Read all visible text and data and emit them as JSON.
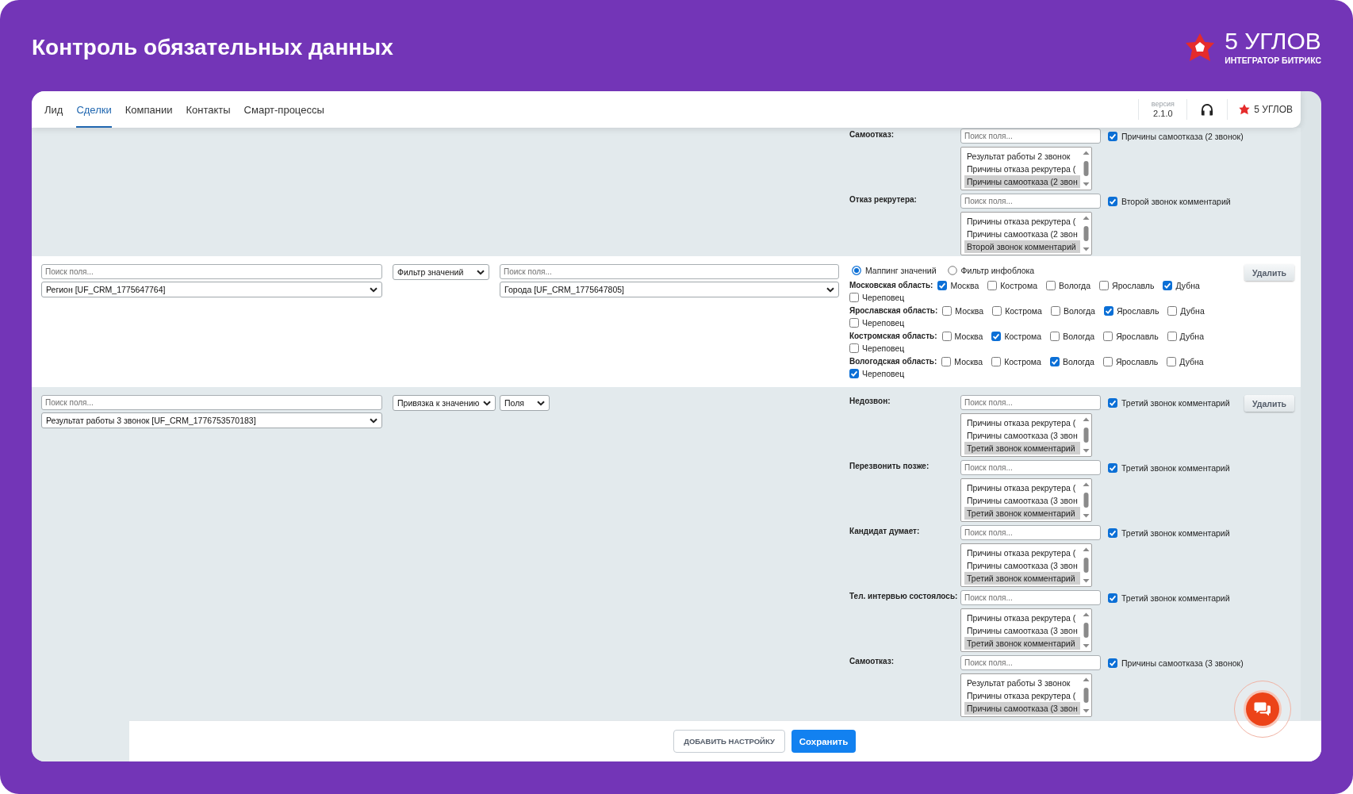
{
  "header": {
    "title": "Контроль обязательных данных",
    "brand": "5 УГЛОВ",
    "tagline": "ИНТЕГРАТОР БИТРИКС"
  },
  "tabs": [
    {
      "label": "Лид",
      "selected": false
    },
    {
      "label": "Сделки",
      "selected": true
    },
    {
      "label": "Компании",
      "selected": false
    },
    {
      "label": "Контакты",
      "selected": false
    },
    {
      "label": "Смарт-процессы",
      "selected": false
    }
  ],
  "toolbar": {
    "version_caption": "версия",
    "version": "2.1.0",
    "brand": "5 УГЛОВ"
  },
  "rows": [
    {
      "kind": "binding",
      "entries": [
        {
          "label": "Самоотказ:",
          "search": {
            "placeholder": "Поиск поля..."
          },
          "check": {
            "label": "Причины самоотказа (2 звонок)",
            "checked": true
          },
          "options": [
            {
              "label": "Результат работы 2 звонок",
              "selected": false
            },
            {
              "label": "Причины отказа рекрутера (",
              "selected": false
            },
            {
              "label": "Причины самоотказа (2 звон",
              "selected": true
            }
          ]
        },
        {
          "label": "Отказ рекрутера:",
          "search": {
            "placeholder": "Поиск поля..."
          },
          "check": {
            "label": "Второй звонок комментарий",
            "checked": true
          },
          "options": [
            {
              "label": "Причины отказа рекрутера (",
              "selected": false
            },
            {
              "label": "Причины самоотказа (2 звон",
              "selected": false
            },
            {
              "label": "Второй звонок комментарий",
              "selected": true
            }
          ]
        }
      ]
    },
    {
      "kind": "filter",
      "source_search": {
        "placeholder": "Поиск поля..."
      },
      "source_field": "Регион [UF_CRM_1775647764]",
      "mode": "Фильтр значений",
      "target_search": {
        "placeholder": "Поиск поля..."
      },
      "target_field": "Города [UF_CRM_1775647805]",
      "delete": "Удалить",
      "modes": [
        {
          "label": "Маппинг значений",
          "selected": true
        },
        {
          "label": "Фильтр инфоблока",
          "selected": false
        }
      ],
      "groups": [
        {
          "label": "Московская область:",
          "cities": [
            {
              "label": "Москва",
              "checked": true
            },
            {
              "label": "Кострома",
              "checked": false
            },
            {
              "label": "Вологда",
              "checked": false
            },
            {
              "label": "Ярославль",
              "checked": false
            },
            {
              "label": "Дубна",
              "checked": true
            },
            {
              "label": "Череповец",
              "checked": false
            }
          ]
        },
        {
          "label": "Ярославская область:",
          "cities": [
            {
              "label": "Москва",
              "checked": false
            },
            {
              "label": "Кострома",
              "checked": false
            },
            {
              "label": "Вологда",
              "checked": false
            },
            {
              "label": "Ярославль",
              "checked": true
            },
            {
              "label": "Дубна",
              "checked": false
            },
            {
              "label": "Череповец",
              "checked": false
            }
          ]
        },
        {
          "label": "Костромская область:",
          "cities": [
            {
              "label": "Москва",
              "checked": false
            },
            {
              "label": "Кострома",
              "checked": true
            },
            {
              "label": "Вологда",
              "checked": false
            },
            {
              "label": "Ярославль",
              "checked": false
            },
            {
              "label": "Дубна",
              "checked": false
            },
            {
              "label": "Череповец",
              "checked": false
            }
          ]
        },
        {
          "label": "Вологодская область:",
          "cities": [
            {
              "label": "Москва",
              "checked": false
            },
            {
              "label": "Кострома",
              "checked": false
            },
            {
              "label": "Вологда",
              "checked": true
            },
            {
              "label": "Ярославль",
              "checked": false
            },
            {
              "label": "Дубна",
              "checked": false
            },
            {
              "label": "Череповец",
              "checked": true
            }
          ]
        }
      ]
    },
    {
      "kind": "binding",
      "source_search": {
        "placeholder": "Поиск поля..."
      },
      "source_field": "Результат работы 3 звонок [UF_CRM_1776753570183]",
      "mode": "Привязка к значению",
      "target_type": "Поля",
      "delete": "Удалить",
      "entries": [
        {
          "label": "Недозвон:",
          "search": {
            "placeholder": "Поиск поля..."
          },
          "check": {
            "label": "Третий звонок комментарий",
            "checked": true
          },
          "options": [
            {
              "label": "Причины отказа рекрутера (",
              "selected": false
            },
            {
              "label": "Причины самоотказа (3 звон",
              "selected": false
            },
            {
              "label": "Третий звонок комментарий",
              "selected": true
            }
          ]
        },
        {
          "label": "Перезвонить позже:",
          "search": {
            "placeholder": "Поиск поля..."
          },
          "check": {
            "label": "Третий звонок комментарий",
            "checked": true
          },
          "options": [
            {
              "label": "Причины отказа рекрутера (",
              "selected": false
            },
            {
              "label": "Причины самоотказа (3 звон",
              "selected": false
            },
            {
              "label": "Третий звонок комментарий",
              "selected": true
            }
          ]
        },
        {
          "label": "Кандидат думает:",
          "search": {
            "placeholder": "Поиск поля..."
          },
          "check": {
            "label": "Третий звонок комментарий",
            "checked": true
          },
          "options": [
            {
              "label": "Причины отказа рекрутера (",
              "selected": false
            },
            {
              "label": "Причины самоотказа (3 звон",
              "selected": false
            },
            {
              "label": "Третий звонок комментарий",
              "selected": true
            }
          ]
        },
        {
          "label": "Тел. интервью состоялось:",
          "search": {
            "placeholder": "Поиск поля..."
          },
          "check": {
            "label": "Третий звонок комментарий",
            "checked": true
          },
          "options": [
            {
              "label": "Причины отказа рекрутера (",
              "selected": false
            },
            {
              "label": "Причины самоотказа (3 звон",
              "selected": false
            },
            {
              "label": "Третий звонок комментарий",
              "selected": true
            }
          ]
        },
        {
          "label": "Самоотказ:",
          "search": {
            "placeholder": "Поиск поля..."
          },
          "check": {
            "label": "Причины самоотказа (3 звонок)",
            "checked": true
          },
          "options": [
            {
              "label": "Результат работы 3 звонок",
              "selected": false
            },
            {
              "label": "Причины отказа рекрутера (",
              "selected": false
            },
            {
              "label": "Причины самоотказа (3 звон",
              "selected": true
            }
          ]
        }
      ]
    }
  ],
  "footer": {
    "actions": [
      {
        "kind": "secondary",
        "label": "ДОБАВИТЬ НАСТРОЙКУ"
      },
      {
        "kind": "primary",
        "label": "Сохранить"
      }
    ]
  }
}
